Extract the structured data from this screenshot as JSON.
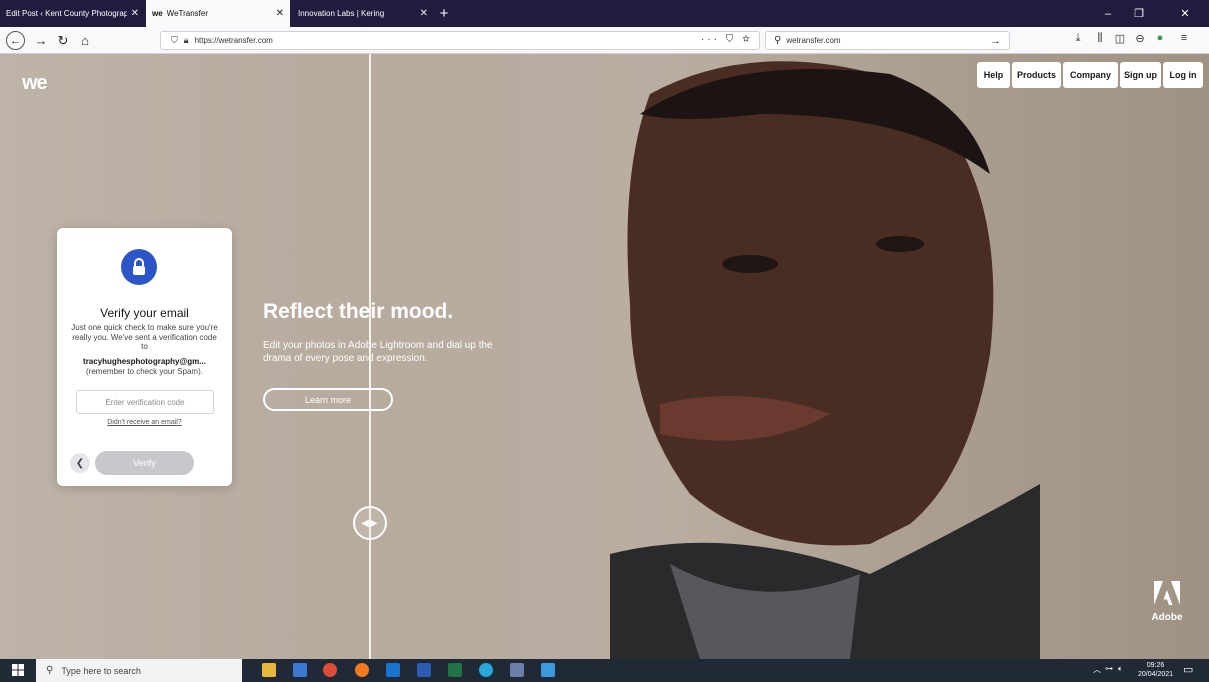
{
  "browser": {
    "tabs": [
      {
        "title": "Edit Post ‹ Kent County Photograph",
        "close": "✕"
      },
      {
        "logo": "we",
        "title": "WeTransfer",
        "close": "✕"
      },
      {
        "title": "Innovation Labs | Kering",
        "close": "✕"
      }
    ],
    "new_tab": "+",
    "url": "https://wetransfer.com",
    "search_text": "wetransfer.com",
    "window_controls": {
      "minimize": "–",
      "restore": "❐",
      "close": "✕"
    }
  },
  "site": {
    "logo_text": "we",
    "nav": {
      "help": "Help",
      "products": "Products",
      "company": "Company",
      "signup": "Sign up",
      "login": "Log in"
    }
  },
  "verify_card": {
    "title": "Verify your email",
    "body": "Just one quick check to make sure you're really you. We've sent a verification code to",
    "email": "tracyhughesphotography@gm...",
    "note": "(remember to check your Spam).",
    "code_placeholder": "Enter verification code",
    "resend_link": "Didn't receive an email?",
    "verify_button": "Verify"
  },
  "ad": {
    "headline": "Reflect their mood.",
    "subtext": "Edit your photos in Adobe Lightroom and dial up the drama of every pose and expression.",
    "cta": "Learn more",
    "brand": "Adobe"
  },
  "taskbar": {
    "search_placeholder": "Type here to search",
    "time": "09:26",
    "date": "20/04/2021"
  },
  "colors": {
    "tabbar_bg": "#1f1c3e",
    "accent_blue": "#2c55c8",
    "taskbar_bg": "#202a36"
  }
}
